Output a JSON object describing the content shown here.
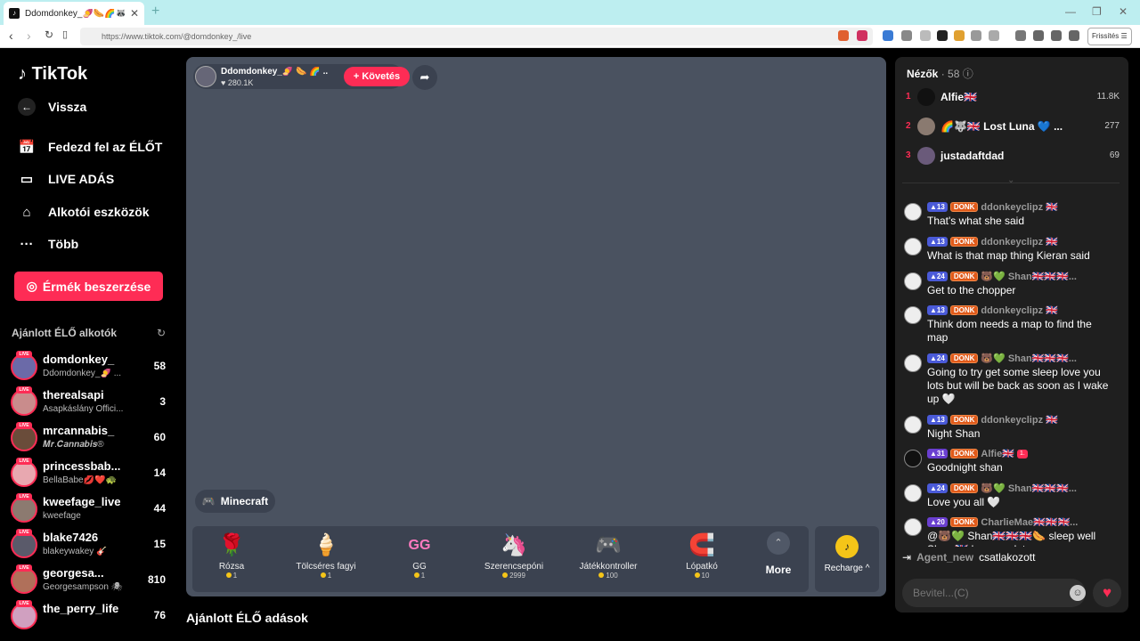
{
  "browser": {
    "tab_title": "Ddomdonkey_🍠🌭🌈🦝🐱🐻",
    "url": "https://www.tiktok.com/@domdonkey_/live",
    "refresh_label": "Frissítés",
    "new_tab": "+"
  },
  "sidebar": {
    "logo": "TikTok",
    "back": "Vissza",
    "nav": [
      {
        "label": "Fedezd fel az ÉLŐT",
        "icon": "live-calendar-icon"
      },
      {
        "label": "LIVE ADÁS",
        "icon": "camera-icon"
      },
      {
        "label": "Alkotói eszközök",
        "icon": "creator-tools-icon"
      },
      {
        "label": "Több",
        "icon": "more-dots-icon"
      }
    ],
    "coin_button": "Érmék beszerzése",
    "recommended_title": "Ajánlott ÉLŐ alkotók",
    "creators": [
      {
        "name": "domdonkey_",
        "sub": "Ddomdonkey_🍠 ...",
        "count": "58",
        "color": "#6b6aa8"
      },
      {
        "name": "therealsapi",
        "sub": "Asapkáslány Offici...",
        "count": "3",
        "color": "#c98c8c"
      },
      {
        "name": "mrcannabis_",
        "sub": "𝑴𝒓.𝑪𝒂𝒏𝒏𝒂𝒃𝒊𝒔®",
        "count": "60",
        "color": "#6a4c3a"
      },
      {
        "name": "princessbab...",
        "sub": "BellaBabe💋❤️🐢",
        "count": "14",
        "color": "#e8a8b0"
      },
      {
        "name": "kweefage_live",
        "sub": "kweefage",
        "count": "44",
        "color": "#8c7a70"
      },
      {
        "name": "blake7426",
        "sub": "blakeywakey 🎸",
        "count": "15",
        "color": "#5a5a6a"
      },
      {
        "name": "georgesa...",
        "sub": "Georgesampson 🕷",
        "count": "810",
        "color": "#b0705a"
      },
      {
        "name": "the_perry_life",
        "sub": "",
        "count": "76",
        "color": "#d0a0c0"
      }
    ]
  },
  "stream": {
    "host_name": "Ddomdonkey_🍠 🌭 🌈 ...",
    "host_likes": "280.1K",
    "follow_label": "+ Követés",
    "game_label": "Minecraft",
    "gifts": [
      {
        "name": "Rózsa",
        "price": "1",
        "icon": "🌹"
      },
      {
        "name": "Tölcséres fagyi",
        "price": "1",
        "icon": "🍦"
      },
      {
        "name": "GG",
        "price": "1",
        "icon": "GG"
      },
      {
        "name": "Szerencsepóni",
        "price": "2999",
        "icon": "🦄"
      },
      {
        "name": "Játékkontroller",
        "price": "100",
        "icon": "🎮"
      },
      {
        "name": "Lópatkó",
        "price": "10",
        "icon": "🧲"
      }
    ],
    "more_label": "More",
    "recharge_label": "Recharge ^",
    "recommended_live_title": "Ajánlott ÉLŐ adások"
  },
  "panel": {
    "viewers_label": "Nézők",
    "viewers_count": "· 58",
    "top_viewers": [
      {
        "rank": "1",
        "name": "Alfie🇬🇧",
        "score": "11.8K",
        "color": "#111"
      },
      {
        "rank": "2",
        "name": "🌈🐺🇬🇧 Lost Luna 💙 ...",
        "score": "277",
        "color": "#8a7a70"
      },
      {
        "rank": "3",
        "name": "justadaftdad",
        "score": "69",
        "color": "#6a5a7a"
      }
    ],
    "messages": [
      {
        "lvl": "13",
        "user": "ddonkeyclipz 🇬🇧",
        "text": "That's what she said"
      },
      {
        "lvl": "13",
        "user": "ddonkeyclipz 🇬🇧",
        "text": "What is that map thing Kieran said"
      },
      {
        "lvl": "24",
        "user": "🐻💚 Shan🇬🇧🇬🇧🇬🇧...",
        "text": "Get to the chopper"
      },
      {
        "lvl": "13",
        "user": "ddonkeyclipz 🇬🇧",
        "text": "Think dom needs a map to find the map"
      },
      {
        "lvl": "24",
        "user": "🐻💚 Shan🇬🇧🇬🇧🇬🇧...",
        "text": "Going to try get some sleep love you lots but will be back as soon as I wake up 🤍"
      },
      {
        "lvl": "13",
        "user": "ddonkeyclipz 🇬🇧",
        "text": "Night Shan"
      },
      {
        "lvl": "31",
        "user": "Alfie🇬🇧",
        "text": "Goodnight shan",
        "extra": "1."
      },
      {
        "lvl": "24",
        "user": "🐻💚 Shan🇬🇧🇬🇧🇬🇧...",
        "text": "Love you all 🤍"
      },
      {
        "lvl": "20",
        "user": "CharlieMae🇬🇧🇬🇧🇬🇧...",
        "text": "@🐻💚 Shan🇬🇧🇬🇧🇬🇧🌭 sleep well Shan 🇬🇧 love you lots"
      }
    ],
    "fan_badge": "DONK",
    "join_user": "Agent_new",
    "join_text": "csatlakozott",
    "input_placeholder": "Bevitel...(C)"
  }
}
